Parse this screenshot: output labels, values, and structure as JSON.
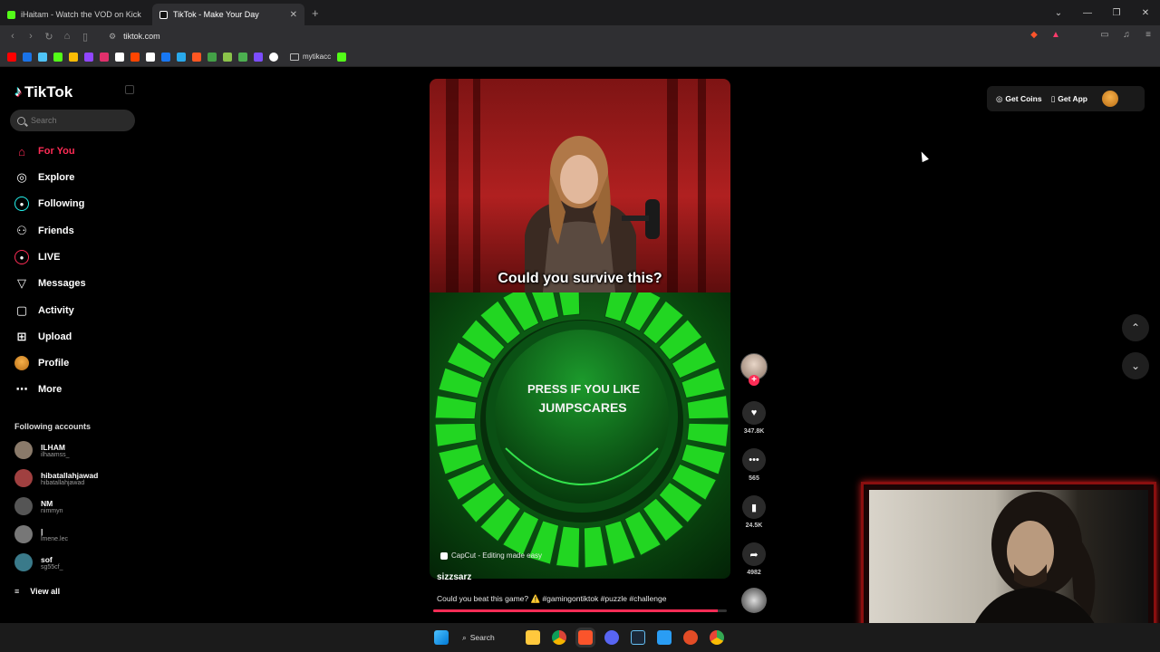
{
  "browser": {
    "tabs": [
      {
        "title": "iHaitam - Watch the VOD on Kick",
        "favicon_color": "#53fc18",
        "active": false
      },
      {
        "title": "TikTok - Make Your Day",
        "favicon_color": "#ffffff",
        "active": true
      }
    ],
    "new_tab": "+",
    "url": "tiktok.com",
    "bookmarks_folder": "mytikacc",
    "bookmark_colors": [
      "#ff0000",
      "#1a73e8",
      "#4fc3f7",
      "#53fc18",
      "#fbbc05",
      "#9146ff",
      "#e1306c",
      "#ffffff",
      "#ff4500",
      "#ffffff",
      "#1877f2",
      "#29a9eb",
      "#ff5722",
      "#43a047",
      "#8bc34a",
      "#4caf50",
      "#7c4dff",
      "#ffffff"
    ]
  },
  "sidebar": {
    "logo": "TikTok",
    "search_placeholder": "Search",
    "nav": [
      {
        "label": "For You",
        "icon": "home-icon",
        "active": true
      },
      {
        "label": "Explore",
        "icon": "compass-icon"
      },
      {
        "label": "Following",
        "icon": "following-icon"
      },
      {
        "label": "Friends",
        "icon": "friends-icon"
      },
      {
        "label": "LIVE",
        "icon": "live-icon"
      },
      {
        "label": "Messages",
        "icon": "messages-icon"
      },
      {
        "label": "Activity",
        "icon": "activity-icon"
      },
      {
        "label": "Upload",
        "icon": "upload-icon"
      },
      {
        "label": "Profile",
        "icon": "profile-avatar"
      },
      {
        "label": "More",
        "icon": "more-icon"
      }
    ],
    "following_title": "Following accounts",
    "following": [
      {
        "name": "ILHAM",
        "handle": "ilhaamss_",
        "color": "#8a7a6a"
      },
      {
        "name": "hibatallahjawad",
        "handle": "hibatallahjawad",
        "color": "#a04040"
      },
      {
        "name": "NM",
        "handle": "nimmyn",
        "color": "#555555"
      },
      {
        "name": "|",
        "handle": "lmene.lec",
        "color": "#777777"
      },
      {
        "name": "sof",
        "handle": "sg55cf_",
        "color": "#3a7a8a"
      }
    ],
    "view_all": "View all"
  },
  "video": {
    "caption_overlay": "Could you survive this?",
    "button_text_line1": "PRESS IF YOU LIKE",
    "button_text_line2": "JUMPSCARES",
    "watermark": "CapCut - Editing made easy",
    "author": "sizzsarz",
    "description": "Could you beat this game? ⚠️ #gamingontiktok #puzzle #challenge",
    "progress": 0.97
  },
  "actions": {
    "likes": "347.8K",
    "comments": "565",
    "saves": "24.5K",
    "shares": "4982"
  },
  "topright": {
    "get_coins": "Get Coins",
    "get_app": "Get App"
  },
  "taskbar": {
    "search": "Search",
    "app_colors": [
      "#ffc83d",
      "#db4437",
      "#fb542b",
      "#5865f2",
      "#1b2838",
      "#2a9df4",
      "#e34c26",
      "#34a853"
    ]
  },
  "colors": {
    "accent": "#fe2c55",
    "wheel_green": "#22d622"
  }
}
